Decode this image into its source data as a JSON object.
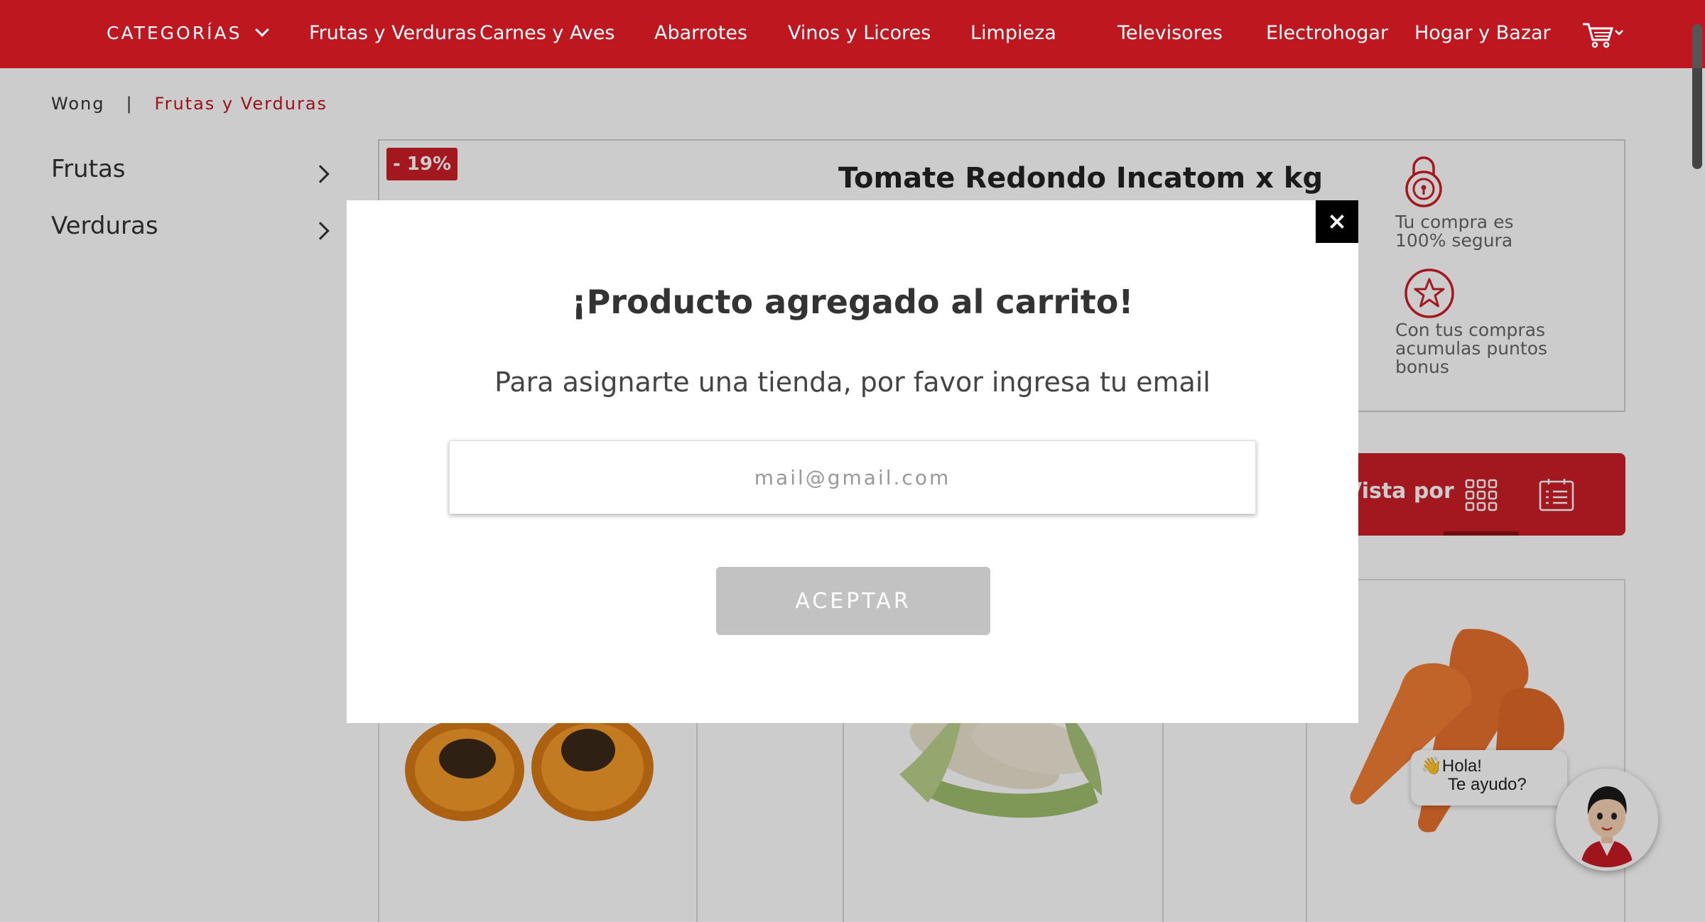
{
  "nav": {
    "categories_label": "CATEGORÍAS",
    "items": [
      "Frutas y Verduras",
      "Carnes y Aves",
      "Abarrotes",
      "Vinos y Licores",
      "Limpieza",
      "Televisores",
      "Electrohogar",
      "Hogar y Bazar"
    ],
    "cart_icon": "shopping-cart-icon"
  },
  "breadcrumb": {
    "home": "Wong",
    "separator": "|",
    "current": "Frutas y Verduras"
  },
  "sidebar": {
    "items": [
      {
        "label": "Frutas"
      },
      {
        "label": "Verduras"
      }
    ]
  },
  "product": {
    "discount": "- 19%",
    "title": "Tomate Redondo Incatom x kg"
  },
  "trust": {
    "secure": "Tu compra es 100% segura",
    "bonus": "Con tus compras acumulas puntos bonus"
  },
  "view": {
    "label": "Vista por",
    "grid_icon": "grid-view-icon",
    "list_icon": "list-view-icon"
  },
  "chat": {
    "line1": "Hola!",
    "line2": "Te ayudo?"
  },
  "modal": {
    "title": "¡Producto agregado al carrito!",
    "subtitle": "Para asignarte una tienda, por favor ingresa tu email",
    "email_value": "",
    "email_placeholder": "mail@gmail.com",
    "accept_label": "ACEPTAR"
  },
  "colors": {
    "brand_red": "#bf1720",
    "badge_red": "#cc1f26",
    "button_disabled": "#c2c2c2",
    "overlay": "rgba(0,0,0,0.2)"
  }
}
